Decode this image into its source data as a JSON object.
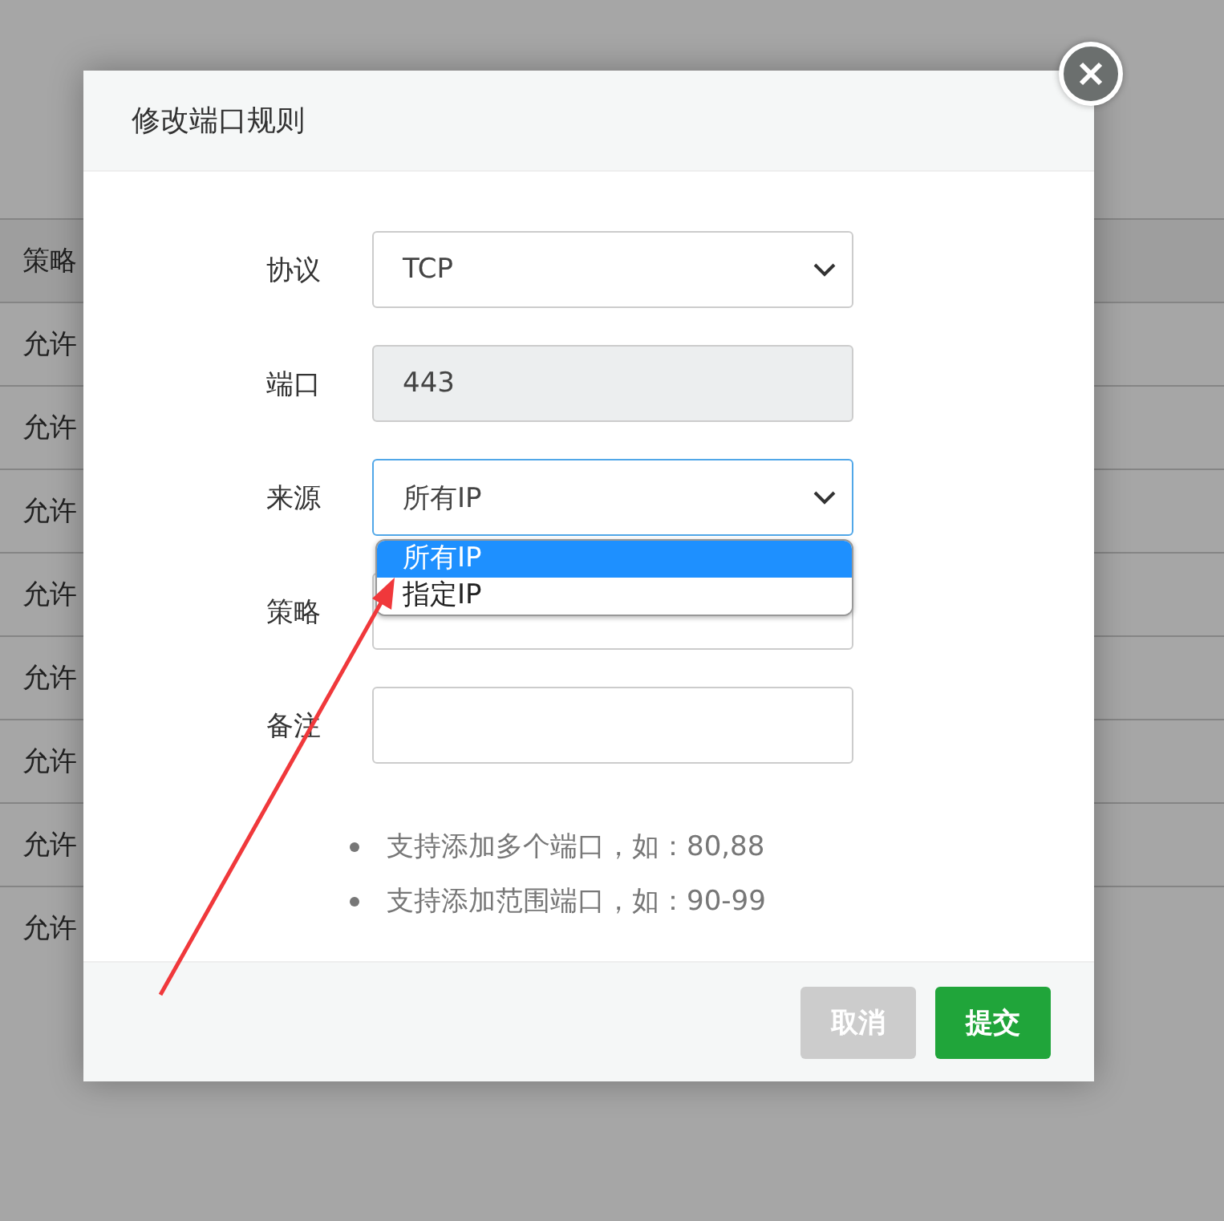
{
  "background_table": {
    "header": "策略",
    "rows": [
      "允许",
      "允许",
      "允许",
      "允许",
      "允许",
      "允许",
      "允许",
      "允许"
    ]
  },
  "dialog": {
    "title": "修改端口规则",
    "fields": [
      {
        "label": "协议",
        "kind": "select",
        "value": "TCP",
        "expanded": false
      },
      {
        "label": "端口",
        "kind": "readonly",
        "value": "443"
      },
      {
        "label": "来源",
        "kind": "select",
        "value": "所有IP",
        "expanded": true,
        "options": [
          {
            "label": "所有IP",
            "selected": true
          },
          {
            "label": "指定IP",
            "selected": false
          }
        ]
      },
      {
        "label": "策略",
        "kind": "select",
        "expanded": false
      },
      {
        "label": "备注",
        "kind": "text"
      }
    ],
    "tips": [
      "支持添加多个端口，如：80,88",
      "支持添加范围端口，如：90-99"
    ],
    "buttons": [
      {
        "label": "取消",
        "kind": "cancel"
      },
      {
        "label": "提交",
        "kind": "submit"
      }
    ]
  },
  "annotation": {
    "kind": "arrow"
  }
}
